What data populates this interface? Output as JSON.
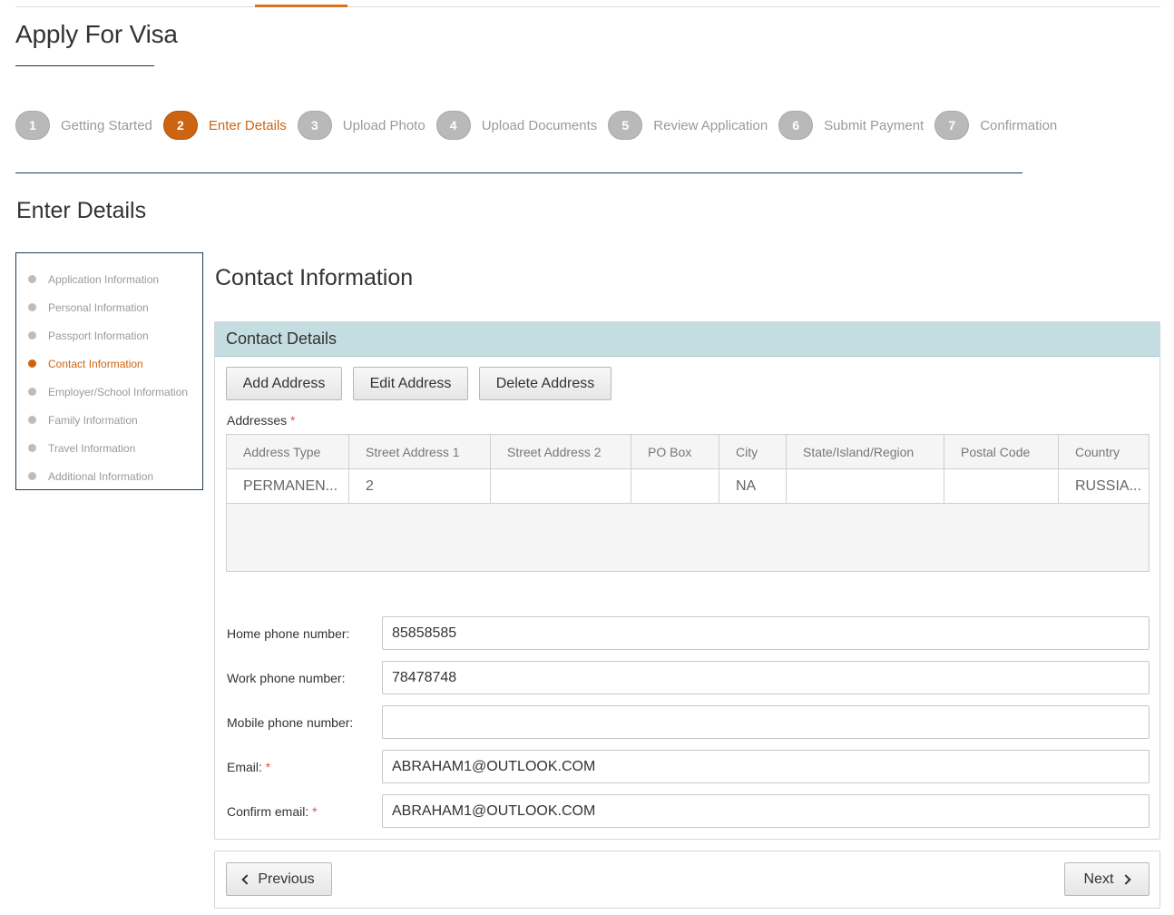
{
  "page": {
    "title": "Apply For Visa",
    "section_title": "Enter Details",
    "content_title": "Contact Information"
  },
  "steps": [
    {
      "num": "1",
      "label": "Getting Started"
    },
    {
      "num": "2",
      "label": "Enter Details"
    },
    {
      "num": "3",
      "label": "Upload Photo"
    },
    {
      "num": "4",
      "label": "Upload Documents"
    },
    {
      "num": "5",
      "label": "Review Application"
    },
    {
      "num": "6",
      "label": "Submit Payment"
    },
    {
      "num": "7",
      "label": "Confirmation"
    }
  ],
  "sidenav": [
    {
      "label": "Application Information"
    },
    {
      "label": "Personal Information"
    },
    {
      "label": "Passport Information"
    },
    {
      "label": "Contact Information"
    },
    {
      "label": "Employer/School Information"
    },
    {
      "label": "Family Information"
    },
    {
      "label": "Travel Information"
    },
    {
      "label": "Additional Information"
    }
  ],
  "panel": {
    "header": "Contact Details",
    "add_label": "Add Address",
    "edit_label": "Edit Address",
    "delete_label": "Delete Address",
    "addresses_label": "Addresses",
    "required_mark": "*"
  },
  "table": {
    "columns": [
      "Address Type",
      "Street Address 1",
      "Street Address 2",
      "PO Box",
      "City",
      "State/Island/Region",
      "Postal Code",
      "Country"
    ],
    "rows": [
      [
        "PERMANEN...",
        "2",
        "",
        "",
        "NA",
        "",
        "",
        "RUSSIA..."
      ]
    ]
  },
  "form": {
    "home_label": "Home phone number:",
    "home_value": "85858585",
    "work_label": "Work phone number:",
    "work_value": "78478748",
    "mobile_label": "Mobile phone number:",
    "mobile_value": "",
    "email_label": "Email:",
    "email_value": "ABRAHAM1@OUTLOOK.COM",
    "confirm_label": "Confirm email:",
    "confirm_value": "ABRAHAM1@OUTLOOK.COM"
  },
  "footer": {
    "previous_label": "Previous",
    "next_label": "Next"
  },
  "colors": {
    "accent": "#cc6412",
    "panel_header": "#c4dde1",
    "navy_rule": "#1e3d4f"
  }
}
